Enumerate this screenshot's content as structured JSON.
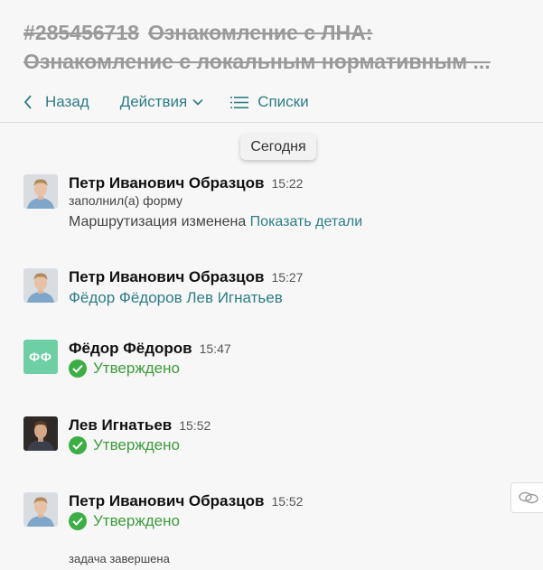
{
  "header": {
    "task_number": "#285456718",
    "title_line1": "Ознакомление с ЛНА:",
    "title_line2": "Ознакомление с локальным нормативным ..."
  },
  "toolbar": {
    "back_label": "Назад",
    "actions_label": "Действия",
    "lists_label": "Списки"
  },
  "date_divider": "Сегодня",
  "messages": [
    {
      "author": "Петр Иванович Образцов",
      "time": "15:22",
      "subtitle": "заполнил(а) форму",
      "text": "Маршрутизация изменена",
      "link": "Показать детали"
    },
    {
      "author": "Петр Иванович Образцов",
      "time": "15:27",
      "names": "Фёдор Фёдоров Лев Игнатьев"
    },
    {
      "author": "Фёдор Фёдоров",
      "time": "15:47",
      "initials": "ФФ",
      "status": "Утверждено"
    },
    {
      "author": "Лев Игнатьев",
      "time": "15:52",
      "status": "Утверждено"
    },
    {
      "author": "Петр Иванович Образцов",
      "time": "15:52",
      "status": "Утверждено",
      "footnote": "задача завершена"
    }
  ],
  "colors": {
    "accent": "#2e7d86",
    "approved": "#3d9b3d",
    "initials_bg": "#6dcfa3"
  },
  "icons": {
    "back": "chevron-left-icon",
    "actions": "chevron-down-icon",
    "lists": "list-icon",
    "approved": "check-circle-icon",
    "side": "link-icon"
  }
}
